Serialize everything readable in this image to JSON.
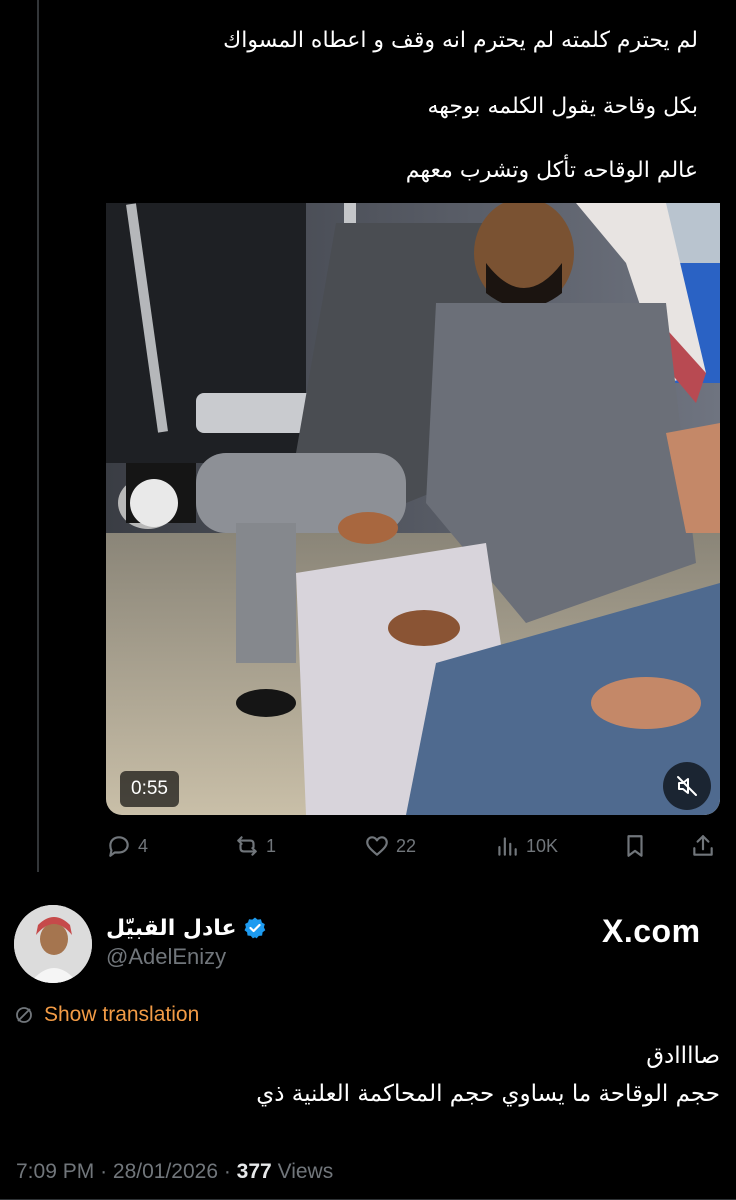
{
  "video": {
    "caption_lines": [
      "لم يحترم كلمته  لم يحترم انه وقف و اعطاه المسواك",
      "بكل وقاحة يقول الكلمه بوجهه",
      "عالم الوقاحه تأكل وتشرب معهم"
    ],
    "duration": "0:55",
    "mute_icon": "speaker-muted-icon"
  },
  "actions": {
    "replies": "4",
    "reposts": "1",
    "likes": "22",
    "views": "10K"
  },
  "author": {
    "name": "عادل القبيّل",
    "handle": "@AdelEnizy",
    "verified_color": "#1d9bf0"
  },
  "source_badge": "X.com",
  "translation_link": "Show translation",
  "tweet": {
    "lines": [
      "صاااادق",
      "حجم الوقاحة ما يساوي حجم المحاكمة العلنية ذي"
    ]
  },
  "meta": {
    "time": "7:09 PM",
    "date": "28/01/2026",
    "views_count": "377",
    "views_label": "Views"
  },
  "colors": {
    "background": "#000000",
    "muted_text": "#71767b",
    "translate_link": "#f29b46"
  }
}
